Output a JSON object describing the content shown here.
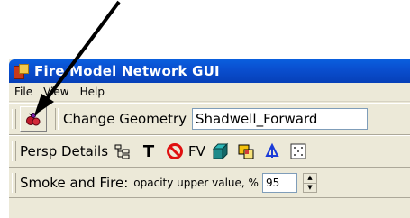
{
  "window": {
    "title": "Fire Model Network GUI"
  },
  "menu": [
    "File",
    "View",
    "Help"
  ],
  "geometry": {
    "label": "Change Geometry",
    "value": "Shadwell_Forward"
  },
  "persp": {
    "label": "Persp Details",
    "t_glyph": "T",
    "fv": "FV"
  },
  "smoke": {
    "label": "Smoke and Fire:",
    "sub_label": "opacity upper value, %",
    "value": "95",
    "up_glyph": "▲",
    "down_glyph": "▼"
  },
  "colors": {
    "title_bar": "#0a4fd0",
    "chrome": "#ece9d8",
    "field_border": "#7f9db9"
  },
  "icons": [
    "bug-network-icon",
    "tree-icon",
    "text-tool-icon",
    "no-entry-icon",
    "cube-icon",
    "overlay-icon",
    "sprinkler-icon",
    "grid-icon"
  ]
}
